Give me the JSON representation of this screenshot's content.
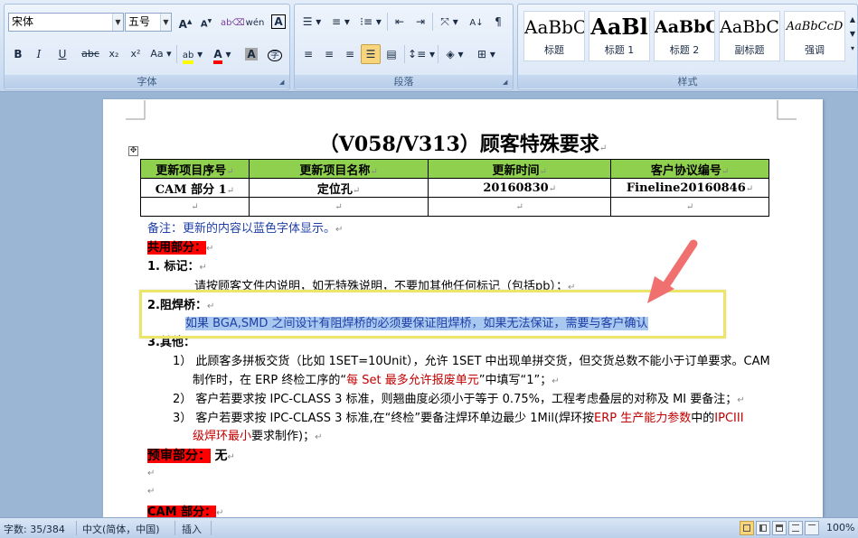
{
  "ribbon": {
    "font_group": {
      "label": "字体",
      "font_name": "宋体",
      "font_size": "五号",
      "grow_font": "A",
      "shrink_font": "A",
      "bold": "B",
      "italic": "I",
      "underline": "U",
      "strikethrough": "abc",
      "subscript": "x₂",
      "superscript": "x²",
      "change_case": "Aa",
      "font_color": "A",
      "char_shading": "A"
    },
    "paragraph_group": {
      "label": "段落"
    },
    "styles_group": {
      "label": "样式",
      "styles": [
        {
          "preview": "AaBbC",
          "name": "标题"
        },
        {
          "preview": "AaBl",
          "name": "标题 1"
        },
        {
          "preview": "AaBbC",
          "name": "标题 2"
        },
        {
          "preview": "AaBbC",
          "name": "副标题"
        },
        {
          "preview": "AaBbCcD",
          "name": "强调"
        }
      ]
    }
  },
  "document": {
    "title": "（V058/V313）顾客特殊要求",
    "table": {
      "headers": [
        "更新项目序号",
        "更新项目名称",
        "更新时间",
        "客户协议编号"
      ],
      "rows": [
        [
          "CAM 部分 1",
          "定位孔",
          "20160830",
          "Fineline20160846"
        ],
        [
          "",
          "",
          "",
          ""
        ]
      ]
    },
    "note": "备注：更新的内容以蓝色字体显示。",
    "common_heading": "共用部分：",
    "marking_heading": "1.   标记：",
    "marking_text": "请按顾客文件内说明，如无特殊说明，不要加其他任何标记（包括pb）；",
    "solder_heading": "2.阻焊桥：",
    "solder_text": "如果 BGA,SMD 之间设计有阻焊桥的必须要保证阻焊桥，如果无法保证，需要与客户确认",
    "other_heading": "3.其他：",
    "item1_a": "1） 此顾客多拼板交货（比如 1SET=10Unit），允许 1SET 中出现单拼交货，但交货总数不能小于订单要求。CAM",
    "item1_b_pre": "制作时，在 ERP 终检工序的“",
    "item1_b_red": "每 Set 最多允许报废单元",
    "item1_b_post": "”中填写“1”；",
    "item2": "2） 客户若要求按 IPC-CLASS 3 标准，则翘曲度必须小于等于 0.75%，工程考虑叠层的对称及 MI 要备注；",
    "item3_pre": "3） 客户若要求按 IPC-CLASS 3 标准,在“终检”要备注焊环单边最少 1Mil(焊环按",
    "item3_red1": "ERP 生产能力参数",
    "item3_mid": "中的",
    "item3_red2": "IPCIII",
    "item3_b_red": "级焊环最小",
    "item3_b_post": "要求制作)；",
    "preaudit_heading": "预审部分：",
    "preaudit_value": "无",
    "cam_heading": "CAM 部分："
  },
  "statusbar": {
    "word_count": "字数: 35/384",
    "language": "中文(简体，中国)",
    "insert_mode": "插入",
    "zoom": "100%"
  },
  "colors": {
    "header_green": "#8fd14f",
    "highlight_red": "#ff0000",
    "note_blue": "#1f3fa8",
    "callout_yellow": "#ece56b",
    "arrow_pink": "#f07070"
  }
}
